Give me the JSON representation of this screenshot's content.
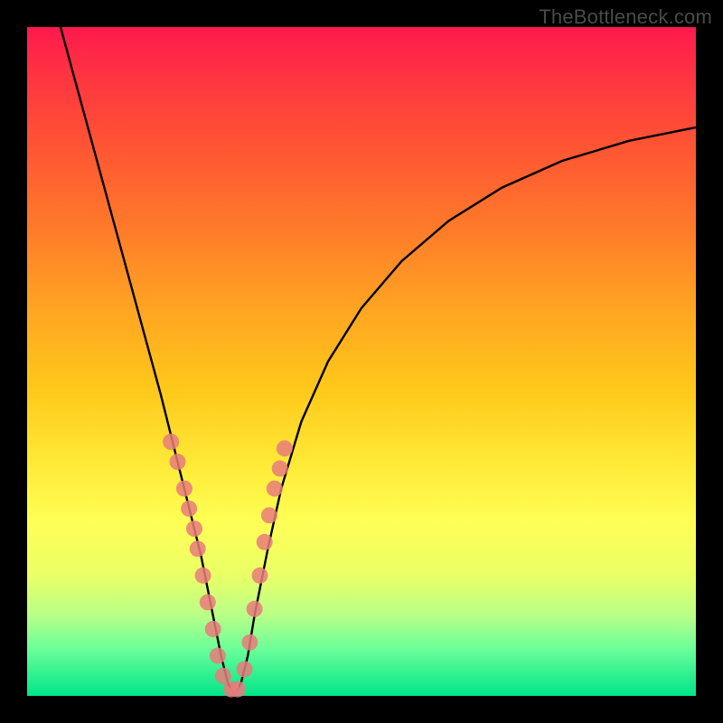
{
  "watermark": "TheBottleneck.com",
  "chart_data": {
    "type": "line",
    "title": "",
    "xlabel": "",
    "ylabel": "",
    "xlim": [
      0,
      100
    ],
    "ylim": [
      0,
      100
    ],
    "series": [
      {
        "name": "bottleneck-curve",
        "x": [
          5,
          8,
          11,
          14,
          17,
          20,
          22,
          24,
          26,
          27,
          28,
          29,
          30,
          31,
          32,
          33,
          34,
          36,
          38,
          41,
          45,
          50,
          56,
          63,
          71,
          80,
          90,
          100
        ],
        "y": [
          100,
          89,
          78,
          67,
          56,
          45,
          37,
          29,
          21,
          16,
          11,
          6,
          2,
          0,
          2,
          6,
          12,
          22,
          31,
          41,
          50,
          58,
          65,
          71,
          76,
          80,
          83,
          85
        ]
      }
    ],
    "markers": {
      "name": "highlight-dots",
      "color": "#e77b7b",
      "x": [
        21.5,
        22.5,
        23.5,
        24.2,
        25.0,
        25.5,
        26.3,
        27.0,
        27.8,
        28.5,
        29.3,
        30.5,
        31.5,
        32.5,
        33.3,
        34.0,
        34.8,
        35.5,
        36.2,
        37.0,
        37.8,
        38.5
      ],
      "y": [
        38,
        35,
        31,
        28,
        25,
        22,
        18,
        14,
        10,
        6,
        3,
        1,
        1,
        4,
        8,
        13,
        18,
        23,
        27,
        31,
        34,
        37
      ]
    },
    "gradient_stops": [
      {
        "pos": 0,
        "color": "#ff1a4d"
      },
      {
        "pos": 18,
        "color": "#ff5533"
      },
      {
        "pos": 42,
        "color": "#ffa422"
      },
      {
        "pos": 64,
        "color": "#ffe633"
      },
      {
        "pos": 82,
        "color": "#eaff66"
      },
      {
        "pos": 100,
        "color": "#00e588"
      }
    ]
  }
}
